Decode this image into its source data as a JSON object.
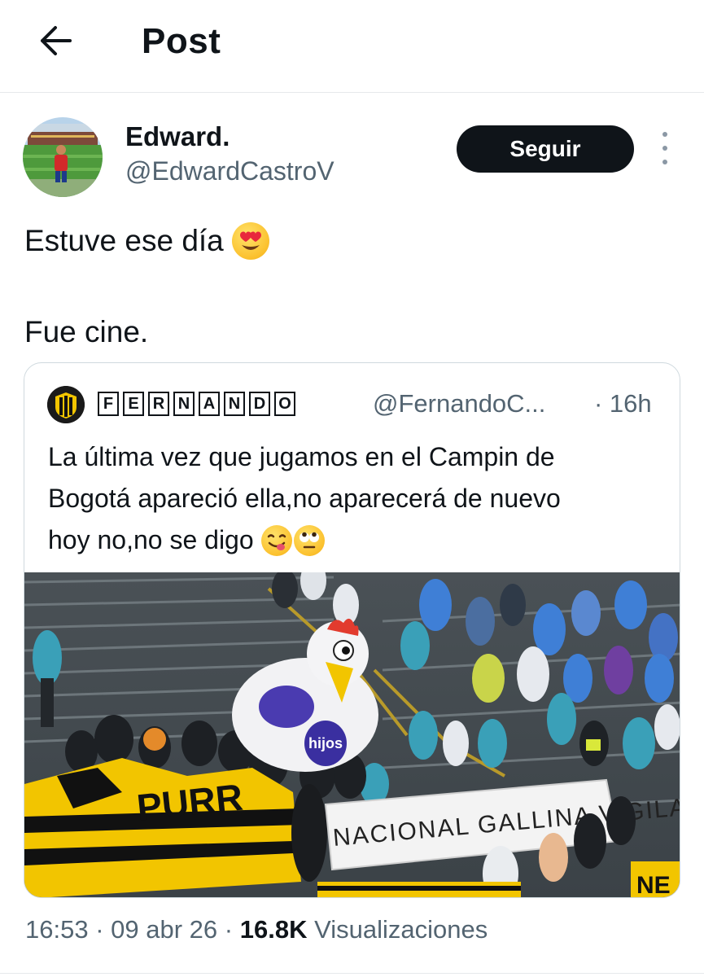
{
  "header": {
    "title": "Post",
    "back_icon": "arrow-left-icon"
  },
  "post": {
    "author_name": "Edward.",
    "author_handle": "@EdwardCastroV",
    "follow_label": "Seguir",
    "more_icon": "vertical-dots-icon",
    "text_line_1": "Estuve ese día ",
    "text_line_1_emoji": "heart-eyes-emoji",
    "text_line_2": "Fue cine.",
    "time": "16:53",
    "sep1": "·",
    "date": "09 abr 26",
    "sep2": "·",
    "views_count": "16.8K",
    "views_label": "Visualizaciones"
  },
  "quoted": {
    "name_letters": [
      "F",
      "E",
      "R",
      "N",
      "A",
      "N",
      "D",
      "O"
    ],
    "handle": "@FernandoC...",
    "time": "· 16h",
    "text_line_1": "La última vez que jugamos en el Campin de",
    "text_line_2": "Bogotá apareció ella,no aparecerá de nuevo",
    "text_line_3": "hoy no,no se digo ",
    "text_line_3_emojis": [
      "yum-face-emoji",
      "rolling-eyes-emoji"
    ],
    "photo": {
      "description_icon": "stadium-photo",
      "balloon_logo": "hijos",
      "banner_text": "NACIONAL GALLINA VIGILANTE",
      "flag_text": "PURR",
      "flag_text_2": "NE"
    }
  },
  "colors": {
    "text": "#0f1419",
    "secondary": "#536471",
    "border": "#cfd9de",
    "follow_bg": "#0f1419",
    "follow_fg": "#ffffff",
    "flag_yellow": "#f2c500",
    "rain_blue": "#3f7fd6"
  }
}
